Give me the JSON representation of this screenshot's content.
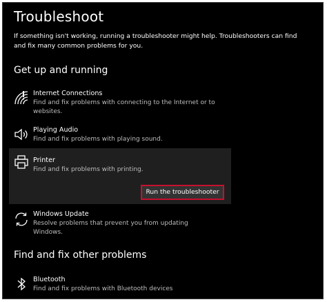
{
  "page": {
    "title": "Troubleshoot",
    "description": "If something isn't working, running a troubleshooter might help. Troubleshooters can find and fix many common problems for you."
  },
  "sections": {
    "get_up_running": "Get up and running",
    "find_fix_other": "Find and fix other problems"
  },
  "items": {
    "internet": {
      "name": "Internet Connections",
      "desc": "Find and fix problems with connecting to the Internet or to websites.",
      "icon": "wifi-icon"
    },
    "audio": {
      "name": "Playing Audio",
      "desc": "Find and fix problems with playing sound.",
      "icon": "speaker-icon"
    },
    "printer": {
      "name": "Printer",
      "desc": "Find and fix problems with printing.",
      "icon": "printer-icon",
      "button_label": "Run the troubleshooter"
    },
    "update": {
      "name": "Windows Update",
      "desc": "Resolve problems that prevent you from updating Windows.",
      "icon": "sync-icon"
    },
    "bluetooth": {
      "name": "Bluetooth",
      "desc": "Find and fix problems with Bluetooth devices",
      "icon": "bluetooth-icon"
    }
  },
  "colors": {
    "background": "#000000",
    "selected_row": "#1f1f1f",
    "button_border_highlight": "#c8102e",
    "secondary_text": "#bdbdbd"
  }
}
